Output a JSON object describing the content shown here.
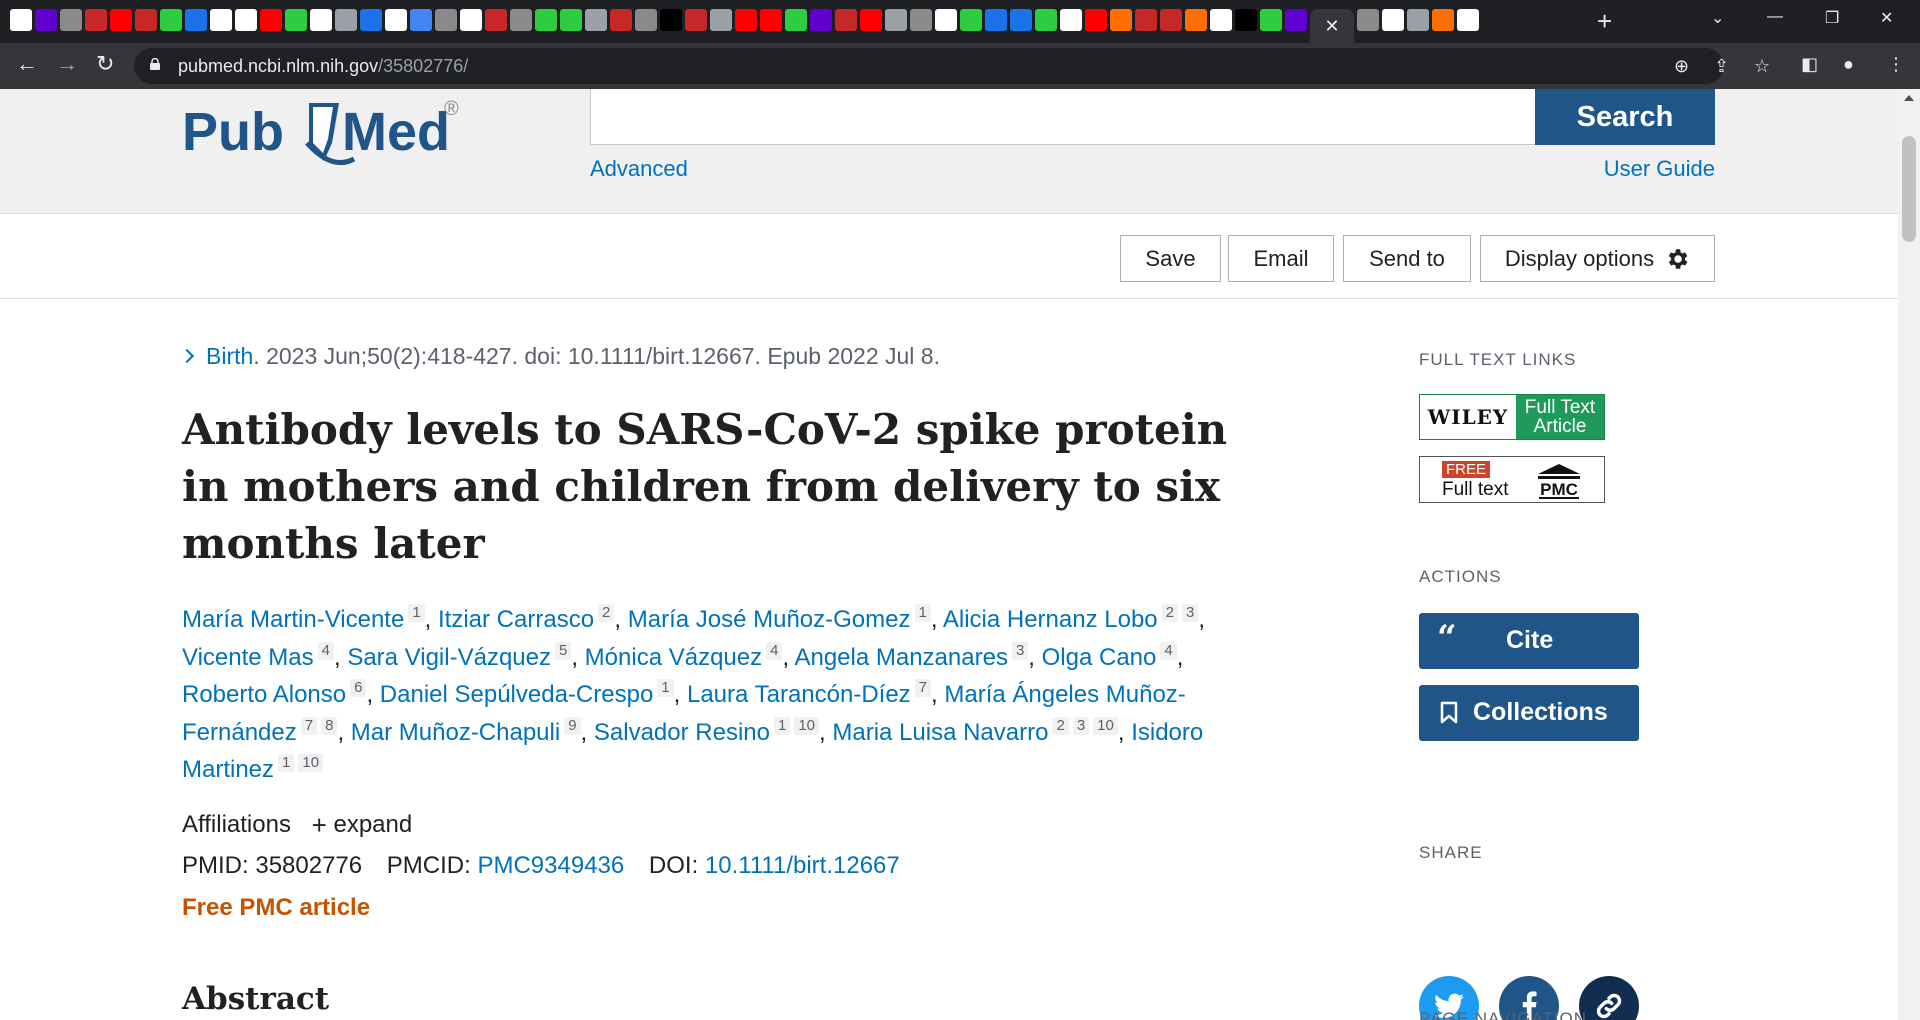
{
  "browser": {
    "active_tab_close": "✕",
    "new_tab": "+",
    "url_domain": "pubmed.ncbi.nlm.nih.gov",
    "url_path": "/35802776/"
  },
  "site": {
    "logo_text_left": "Pub",
    "logo_text_right": "Med",
    "logo_reg": "®",
    "search_value": "",
    "search_button": "Search",
    "advanced_link": "Advanced",
    "user_guide_link": "User Guide"
  },
  "actions": {
    "save": "Save",
    "email": "Email",
    "send_to": "Send to",
    "display_options": "Display options"
  },
  "article": {
    "journal": "Birth.",
    "citation_rest": " 2023 Jun;50(2):418-427. doi: 10.1111/birt.12667. Epub 2022 Jul 8.",
    "title": "Antibody levels to SARS-CoV-2 spike protein in mothers and children from delivery to six months later",
    "authors": [
      {
        "name": "María Martin-Vicente",
        "affs": [
          "1"
        ]
      },
      {
        "name": "Itziar Carrasco",
        "affs": [
          "2"
        ]
      },
      {
        "name": "María José Muñoz-Gomez",
        "affs": [
          "1"
        ]
      },
      {
        "name": "Alicia Hernanz Lobo",
        "affs": [
          "2",
          "3"
        ]
      },
      {
        "name": "Vicente Mas",
        "affs": [
          "4"
        ]
      },
      {
        "name": "Sara Vigil-Vázquez",
        "affs": [
          "5"
        ]
      },
      {
        "name": "Mónica Vázquez",
        "affs": [
          "4"
        ]
      },
      {
        "name": "Angela Manzanares",
        "affs": [
          "3"
        ]
      },
      {
        "name": "Olga Cano",
        "affs": [
          "4"
        ]
      },
      {
        "name": "Roberto Alonso",
        "affs": [
          "6"
        ]
      },
      {
        "name": "Daniel Sepúlveda-Crespo",
        "affs": [
          "1"
        ]
      },
      {
        "name": "Laura Tarancón-Díez",
        "affs": [
          "7"
        ]
      },
      {
        "name": "María Ángeles Muñoz-Fernández",
        "affs": [
          "7",
          "8"
        ]
      },
      {
        "name": "Mar Muñoz-Chapuli",
        "affs": [
          "9"
        ]
      },
      {
        "name": "Salvador Resino",
        "affs": [
          "1",
          "10"
        ]
      },
      {
        "name": "Maria Luisa Navarro",
        "affs": [
          "2",
          "3",
          "10"
        ]
      },
      {
        "name": "Isidoro Martinez",
        "affs": [
          "1",
          "10"
        ]
      }
    ],
    "affiliations_label": "Affiliations",
    "expand_label": "expand",
    "pmid_label": "PMID:",
    "pmid": "35802776",
    "pmcid_label": "PMCID:",
    "pmcid": "PMC9349436",
    "doi_label": "DOI:",
    "doi": "10.1111/birt.12667",
    "free_pmc": "Free PMC article",
    "abstract_heading": "Abstract"
  },
  "sidebar": {
    "full_text_links": "FULL TEXT LINKS",
    "wiley_brand": "WILEY",
    "wiley_line1": "Full Text",
    "wiley_line2": "Article",
    "pmc_free": "FREE",
    "pmc_fulltext": "Full text",
    "pmc_logo": "PMC",
    "actions_heading": "ACTIONS",
    "cite": "Cite",
    "collections": "Collections",
    "share_heading": "SHARE",
    "page_nav_heading": "PAGE NAVIGATION"
  },
  "colors": {
    "link": "#0071bc",
    "brand_dark": "#20558a",
    "free_orange": "#c55300",
    "twitter": "#1d9bf0",
    "facebook": "#20558a",
    "permalink": "#112e51"
  }
}
